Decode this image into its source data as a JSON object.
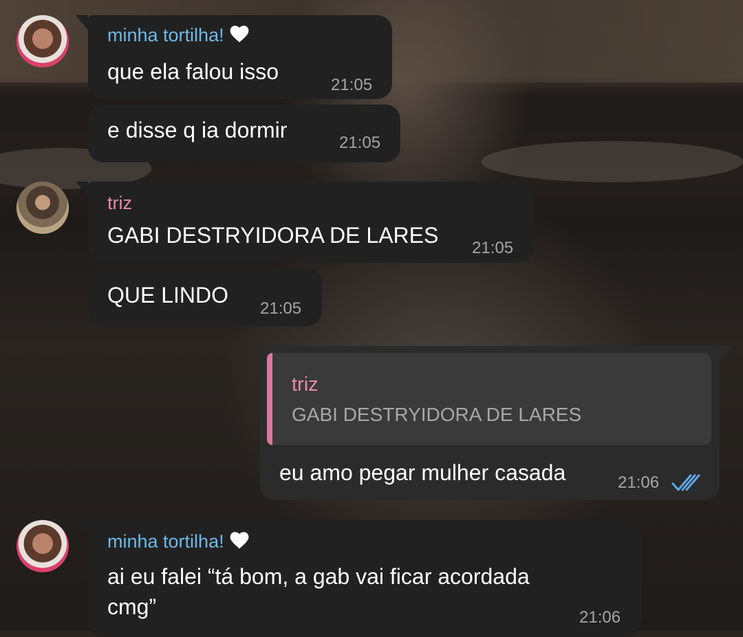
{
  "messages": [
    {
      "sender": "minha tortilha!",
      "text": "que ela falou isso",
      "time": "21:05"
    },
    {
      "text": "e disse q ia dormir",
      "time": "21:05"
    },
    {
      "sender": "triz",
      "text": "GABI DESTRYIDORA DE LARES",
      "time": "21:05"
    },
    {
      "text": "QUE LINDO",
      "time": "21:05"
    },
    {
      "reply": {
        "sender": "triz",
        "text": "GABI DESTRYIDORA DE LARES"
      },
      "text": "eu amo pegar mulher casada",
      "time": "21:06",
      "status": "double-check-read"
    },
    {
      "sender": "minha tortilha!",
      "text_line1": "ai eu falei “tá bom, a gab vai ficar acordada",
      "text_line2": "cmg”",
      "time": "21:06"
    }
  ],
  "colors": {
    "bubble_in": "#212121",
    "bubble_out": "#2b2b2b",
    "sender_blue": "#6fb8e8",
    "sender_pink": "#e68aa8",
    "check_blue": "#5ea8e8",
    "time_gray": "#a6a6a6"
  },
  "icons": {
    "heart": "white-heart-icon",
    "read_status": "double-check-icon"
  }
}
